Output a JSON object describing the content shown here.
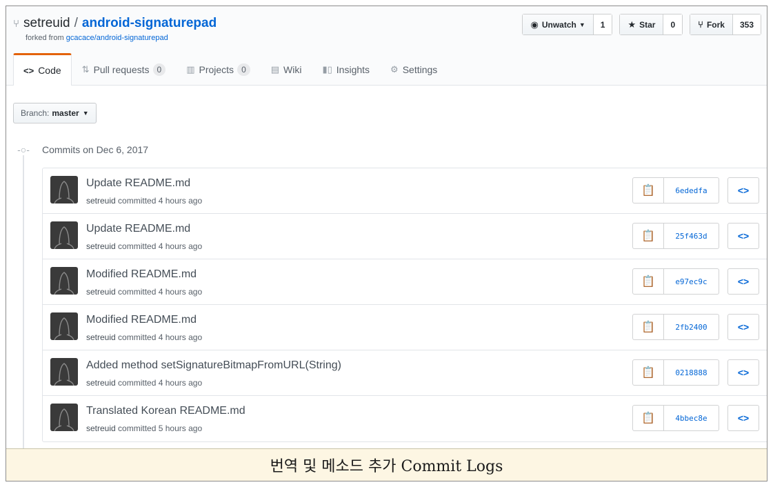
{
  "repo": {
    "owner": "setreuid",
    "separator": "/",
    "name": "android-signaturepad",
    "forked_from_label": "forked from",
    "forked_from_repo": "gcacace/android-signaturepad"
  },
  "actions": {
    "watch_label": "Unwatch",
    "watch_count": "1",
    "star_label": "Star",
    "star_count": "0",
    "fork_label": "Fork",
    "fork_count": "353"
  },
  "tabs": [
    {
      "label": "Code",
      "icon": "code-icon",
      "selected": true
    },
    {
      "label": "Pull requests",
      "icon": "pull-request-icon",
      "counter": "0"
    },
    {
      "label": "Projects",
      "icon": "project-icon",
      "counter": "0"
    },
    {
      "label": "Wiki",
      "icon": "book-icon"
    },
    {
      "label": "Insights",
      "icon": "graph-icon"
    },
    {
      "label": "Settings",
      "icon": "gear-icon"
    }
  ],
  "branch": {
    "label": "Branch:",
    "value": "master"
  },
  "commit_group": {
    "title": "Commits on Dec 6, 2017"
  },
  "commits": [
    {
      "message": "Update README.md",
      "author": "setreuid",
      "action": "committed",
      "time": "4 hours ago",
      "sha": "6ededfa"
    },
    {
      "message": "Update README.md",
      "author": "setreuid",
      "action": "committed",
      "time": "4 hours ago",
      "sha": "25f463d"
    },
    {
      "message": "Modified README.md",
      "author": "setreuid",
      "action": "committed",
      "time": "4 hours ago",
      "sha": "e97ec9c"
    },
    {
      "message": "Modified README.md",
      "author": "setreuid",
      "action": "committed",
      "time": "4 hours ago",
      "sha": "2fb2400"
    },
    {
      "message": "Added method setSignatureBitmapFromURL(String)",
      "author": "setreuid",
      "action": "committed",
      "time": "4 hours ago",
      "sha": "0218888"
    },
    {
      "message": "Translated Korean README.md",
      "author": "setreuid",
      "action": "committed",
      "time": "5 hours ago",
      "sha": "4bbec8e"
    }
  ],
  "caption": "번역 및 메소드 추가 Commit Logs",
  "colors": {
    "link": "#0366d6",
    "tab_accent": "#e36209",
    "caption_bg": "#fdf6e3"
  }
}
